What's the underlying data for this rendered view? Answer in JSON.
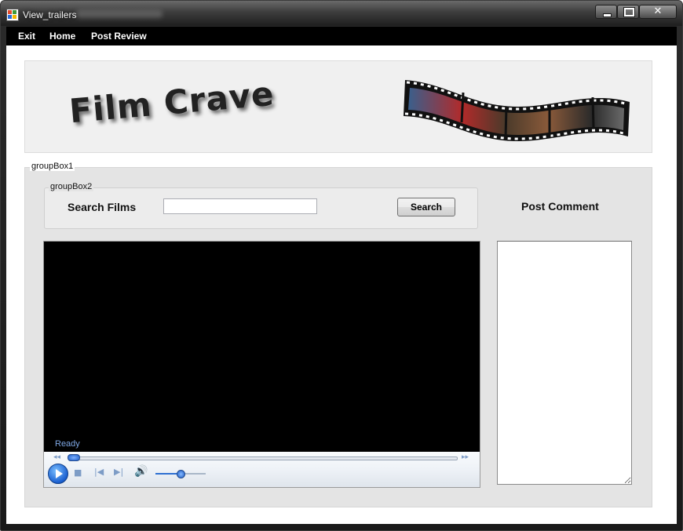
{
  "window": {
    "title": "View_trailers",
    "close_symbol": "✕",
    "controls": [
      "minimize-icon",
      "maximize-icon",
      "close-icon"
    ]
  },
  "menu": {
    "items": [
      "Exit",
      "Home",
      "Post Review"
    ]
  },
  "banner": {
    "logo_text": "Film Crave",
    "image": "filmstrip-image"
  },
  "group1": {
    "label": "groupBox1"
  },
  "group2": {
    "label": "groupBox2"
  },
  "search": {
    "label": "Search Films",
    "value": "",
    "button_label": "Search"
  },
  "comment": {
    "label": "Post Comment",
    "value": ""
  },
  "player": {
    "status": "Ready",
    "seek_position": 0.0,
    "volume_level": 0.5,
    "icons": [
      "play-icon",
      "stop-icon",
      "previous-icon",
      "next-icon",
      "volume-icon",
      "rewind-icon",
      "fast-forward-icon"
    ]
  },
  "colors": {
    "menubar": "#000000",
    "window_frame": "#1e1e1e",
    "group_background": "#e4e4e4",
    "video_background": "#000000",
    "status_text": "#7fa8e6",
    "player_accent": "#1a5fd0"
  }
}
